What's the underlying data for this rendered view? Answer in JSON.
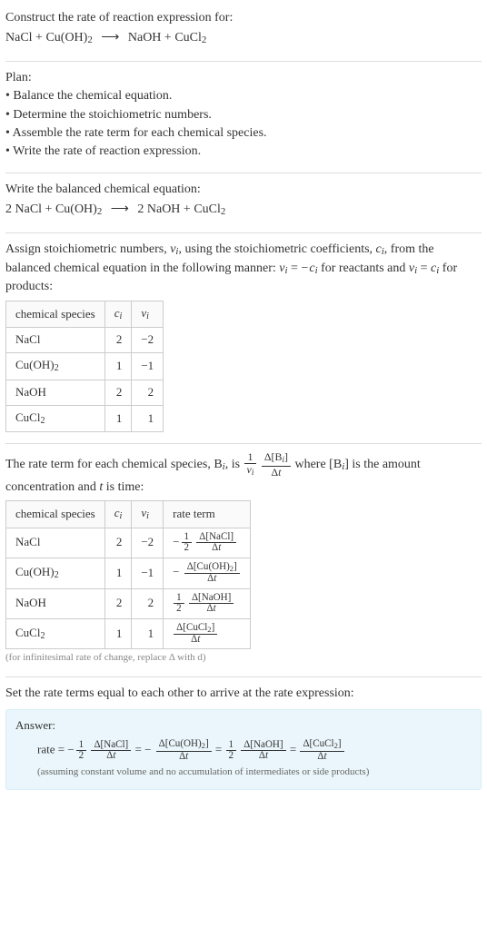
{
  "header": {
    "prompt": "Construct the rate of reaction expression for:",
    "reaction_unbalanced": {
      "lhs": [
        "NaCl",
        "Cu(OH)",
        "2"
      ],
      "rhs": [
        "NaOH",
        "CuCl",
        "2"
      ]
    }
  },
  "plan": {
    "title": "Plan:",
    "items": [
      "Balance the chemical equation.",
      "Determine the stoichiometric numbers.",
      "Assemble the rate term for each chemical species.",
      "Write the rate of reaction expression."
    ]
  },
  "balanced": {
    "intro": "Write the balanced chemical equation:",
    "lhs_coeffs": [
      "2",
      ""
    ],
    "rhs_coeffs": [
      "2",
      ""
    ]
  },
  "assign": {
    "text_a": "Assign stoichiometric numbers, ",
    "text_b": ", using the stoichiometric coefficients, ",
    "text_c": ", from the balanced chemical equation in the following manner: ",
    "text_d": " for reactants and ",
    "text_e": " for products:"
  },
  "table1": {
    "headers": [
      "chemical species"
    ],
    "rows": [
      {
        "sp": "NaCl",
        "c": "2",
        "v": "−2"
      },
      {
        "sp": "Cu(OH)2",
        "c": "1",
        "v": "−1"
      },
      {
        "sp": "NaOH",
        "c": "2",
        "v": "2"
      },
      {
        "sp": "CuCl2",
        "c": "1",
        "v": "1"
      }
    ]
  },
  "rate_term": {
    "text_a": "The rate term for each chemical species, B",
    "text_b": ", is ",
    "text_c": " where [B",
    "text_d": "] is the amount concentration and ",
    "text_e": " is time:"
  },
  "table2": {
    "headers": [
      "chemical species",
      "rate term"
    ],
    "rows": [
      {
        "sp": "NaCl",
        "c": "2",
        "v": "−2"
      },
      {
        "sp": "Cu(OH)2",
        "c": "1",
        "v": "−1"
      },
      {
        "sp": "NaOH",
        "c": "2",
        "v": "2"
      },
      {
        "sp": "CuCl2",
        "c": "1",
        "v": "1"
      }
    ]
  },
  "infinitesimal_hint": "(for infinitesimal rate of change, replace Δ with d)",
  "set_equal": "Set the rate terms equal to each other to arrive at the rate expression:",
  "answer": {
    "label": "Answer:",
    "note": "(assuming constant volume and no accumulation of intermediates or side products)"
  },
  "sym": {
    "nu_i": "ν",
    "c_i": "c",
    "i": "i",
    "delta": "Δ",
    "t": "t",
    "rate": "rate",
    "eq": "=",
    "minus": "−",
    "half_top": "1",
    "half_bot": "2",
    "NaCl": "[NaCl]",
    "CuOH2": "[Cu(OH)2]",
    "NaOH": "[NaOH]",
    "CuCl2": "[CuCl2]",
    "Bi": "[B"
  },
  "chart_data": {
    "type": "table",
    "title": "Stoichiometric numbers",
    "columns": [
      "chemical species",
      "c_i",
      "ν_i"
    ],
    "rows": [
      [
        "NaCl",
        2,
        -2
      ],
      [
        "Cu(OH)2",
        1,
        -1
      ],
      [
        "NaOH",
        2,
        2
      ],
      [
        "CuCl2",
        1,
        1
      ]
    ]
  }
}
